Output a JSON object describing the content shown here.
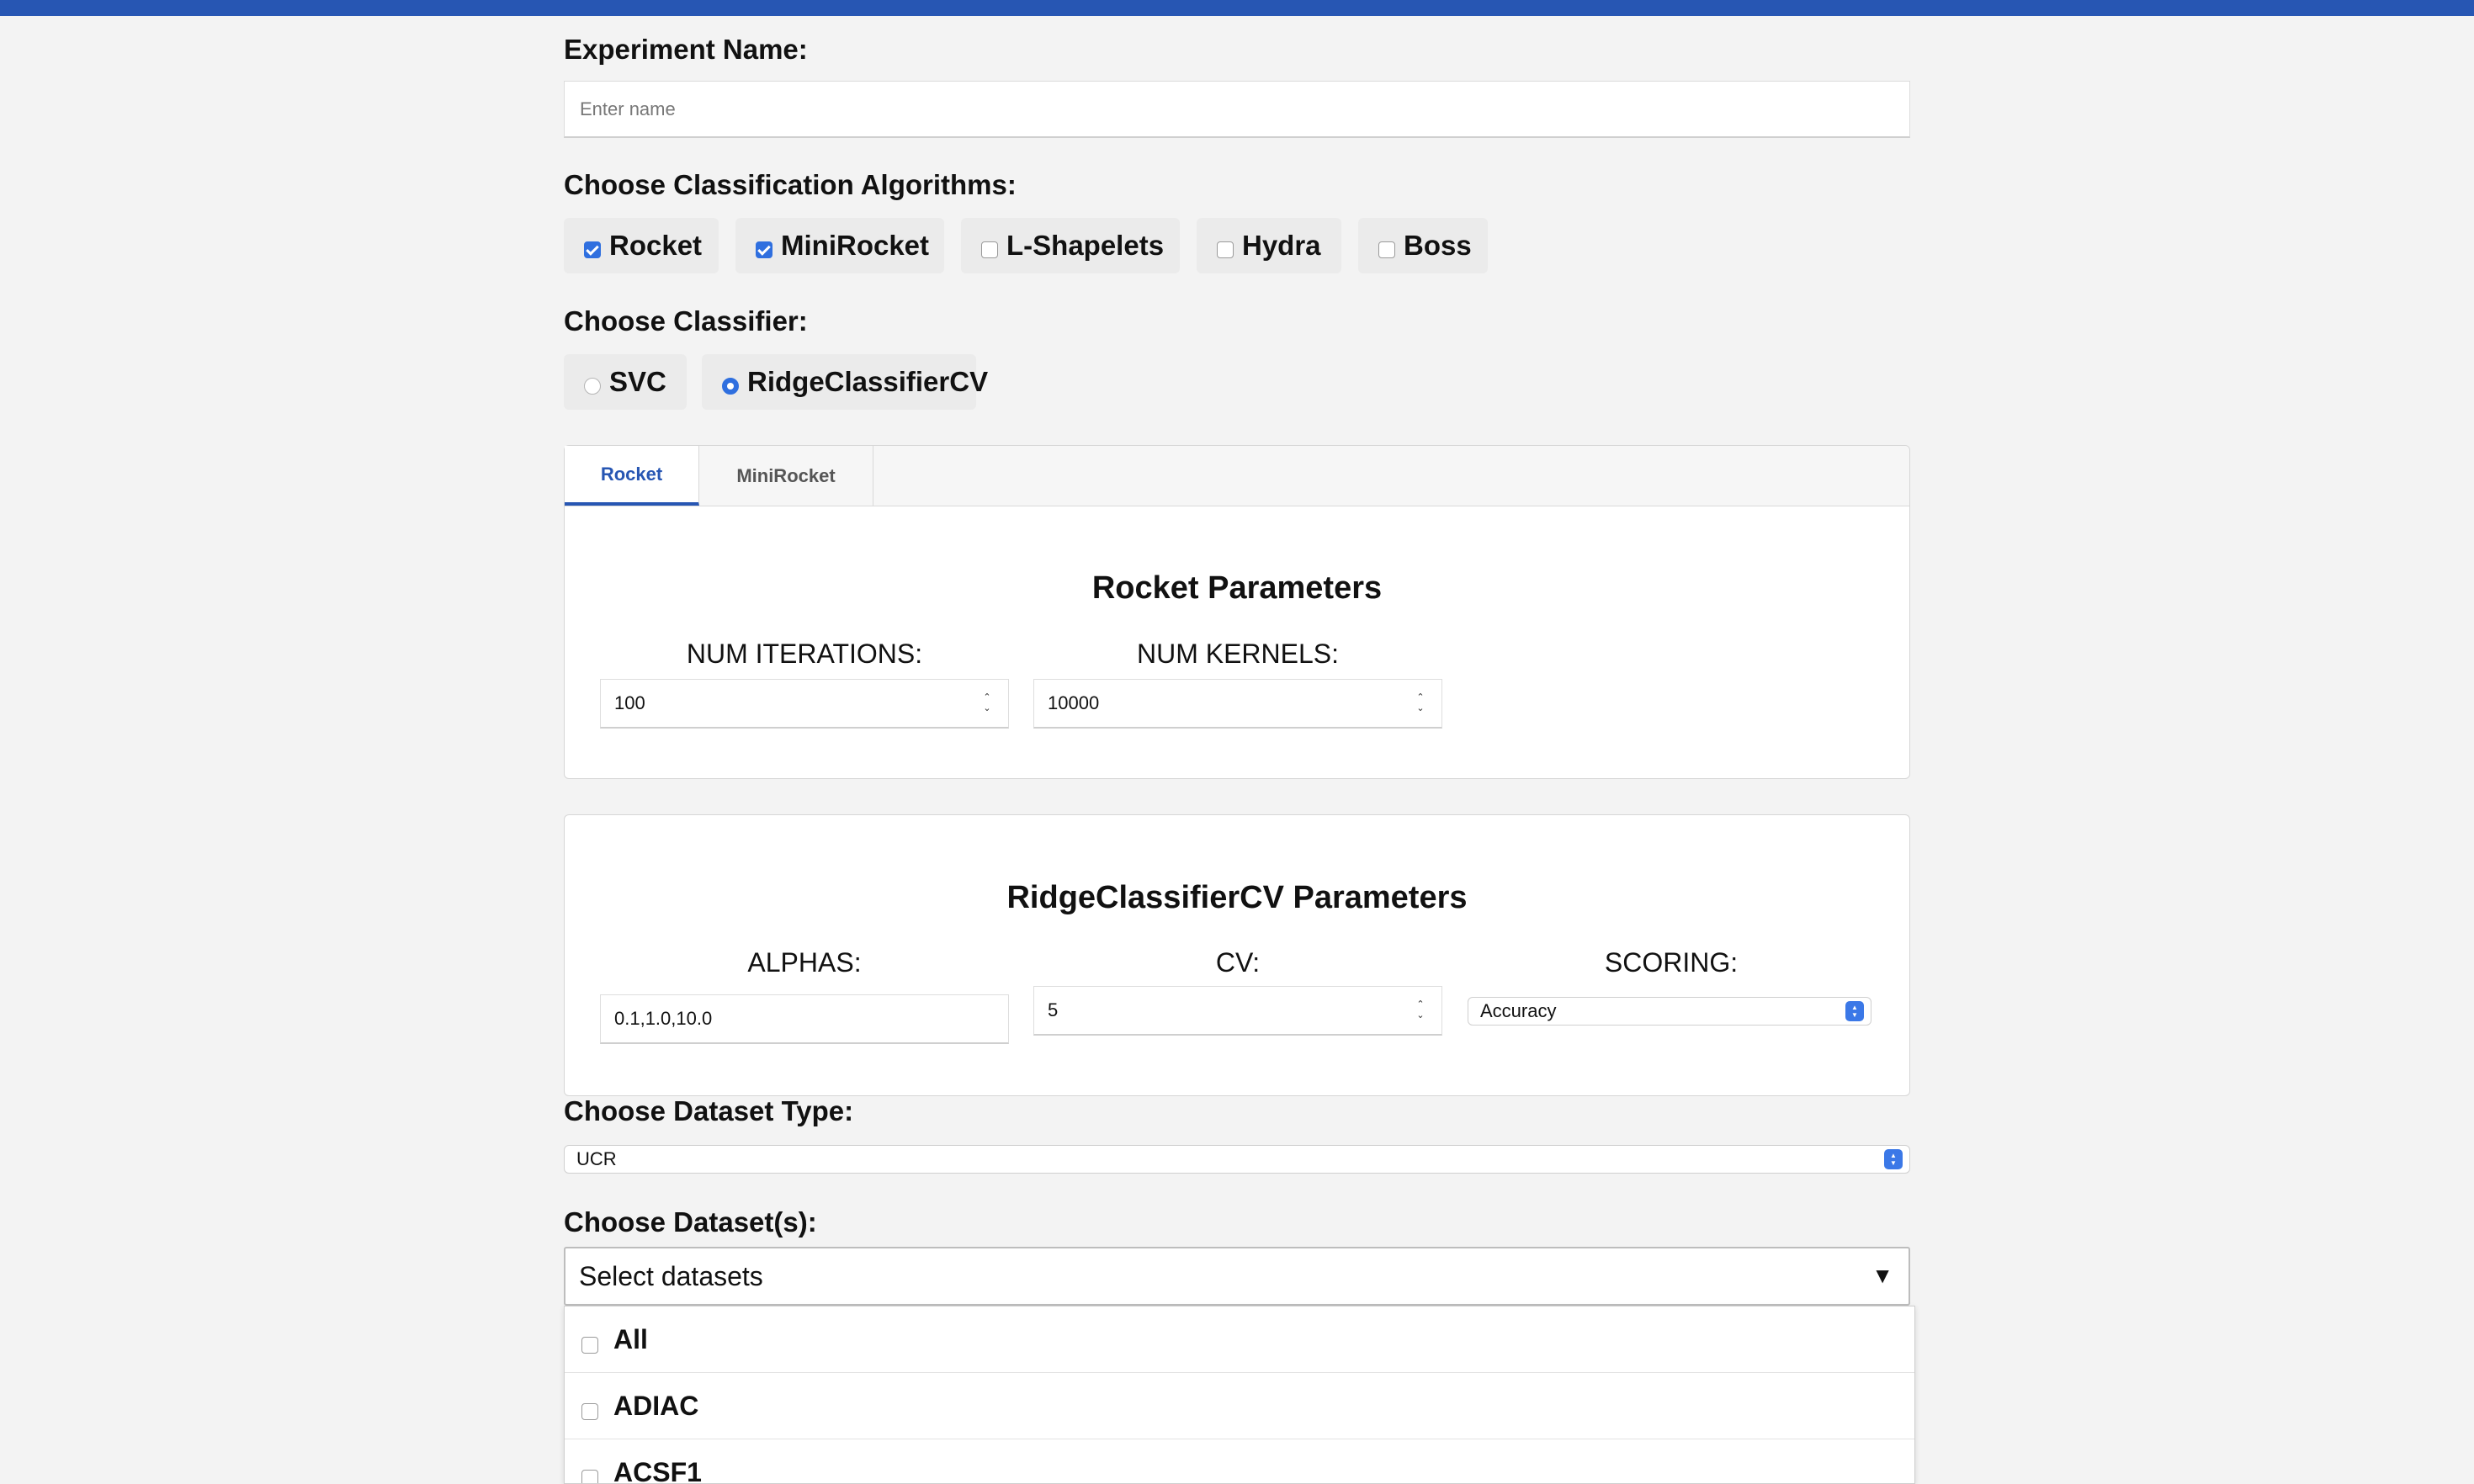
{
  "experiment": {
    "label": "Experiment Name:",
    "placeholder": "Enter name",
    "value": ""
  },
  "algorithms": {
    "label": "Choose Classification Algorithms:",
    "items": [
      {
        "label": "Rocket",
        "checked": true
      },
      {
        "label": "MiniRocket",
        "checked": true
      },
      {
        "label": "L-Shapelets",
        "checked": false
      },
      {
        "label": "Hydra",
        "checked": false
      },
      {
        "label": "Boss",
        "checked": false
      }
    ]
  },
  "classifier": {
    "label": "Choose Classifier:",
    "items": [
      {
        "label": "SVC",
        "selected": false
      },
      {
        "label": "RidgeClassifierCV",
        "selected": true
      }
    ]
  },
  "tabs": {
    "items": [
      {
        "label": "Rocket",
        "active": true
      },
      {
        "label": "MiniRocket",
        "active": false
      }
    ]
  },
  "rocket_params": {
    "title": "Rocket Parameters",
    "num_iterations": {
      "label": "NUM ITERATIONS:",
      "value": "100"
    },
    "num_kernels": {
      "label": "NUM KERNELS:",
      "value": "10000"
    }
  },
  "ridge_params": {
    "title": "RidgeClassifierCV Parameters",
    "alphas": {
      "label": "ALPHAS:",
      "value": "0.1,1.0,10.0"
    },
    "cv": {
      "label": "CV:",
      "value": "5"
    },
    "scoring": {
      "label": "SCORING:",
      "value": "Accuracy"
    }
  },
  "dataset_type": {
    "label": "Choose Dataset Type:",
    "value": "UCR"
  },
  "datasets": {
    "label": "Choose Dataset(s):",
    "placeholder": "Select datasets",
    "caret": "▼",
    "options": [
      {
        "label": "All",
        "checked": false
      },
      {
        "label": "ADIAC",
        "checked": false
      },
      {
        "label": "ACSF1",
        "checked": false
      }
    ]
  },
  "colors": {
    "accent": "#2756b3",
    "checkbox_checked": "#2f6fdf",
    "background": "#f3f3f3"
  }
}
